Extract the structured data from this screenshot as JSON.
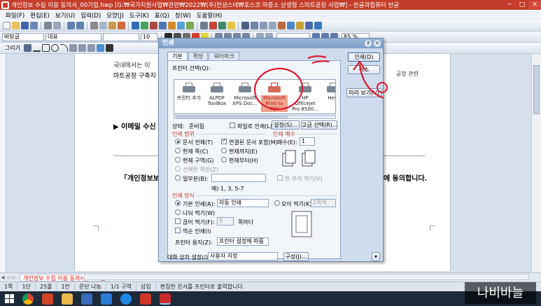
{
  "window": {
    "title": "개인정보 수집 이용 동의서_00기업.hwp [G:₩국가지원사업₩관련₩2022₩(주)전성스테₩포스코 마중소 상생형 스마트공장 사업₩] - 한글과컴퓨터 한글",
    "minimize": "─",
    "maximize": "□",
    "close": "✕"
  },
  "menu": [
    "파일(F)",
    "편집(E)",
    "보기(U)",
    "입력(D)",
    "모양(J)",
    "도구(K)",
    "표(Q)",
    "창(W)",
    "도움말(H)"
  ],
  "toolbar": {
    "style_combo": "바탕글",
    "font_combo": "대표",
    "size_combo": "10",
    "zoom_combo": "85 %",
    "draw_label": "그리기"
  },
  "document": {
    "line1": "국내에서는 이",
    "line2": "마트공장 구축지",
    "line2_right": "공장 관련",
    "bullet": "▶ 이메일 수신",
    "consent_left": "「개인정보보",
    "consent_right": "에 동의합니다."
  },
  "dialog": {
    "title": "인쇄",
    "tabs": [
      "기본",
      "확장",
      "워터마크"
    ],
    "printer_select_label": "프린터 선택(Q):",
    "printers": [
      {
        "name": "프린터 추가",
        "selected": false
      },
      {
        "name": "ALPDF ToolBox",
        "selected": false
      },
      {
        "name": "Microsoft XPS Doc...",
        "selected": false
      },
      {
        "name": "Microsoft Print to PDF",
        "selected": true
      },
      {
        "name": "HP Officejet Pro 8500...",
        "selected": false
      },
      {
        "name": "Hew",
        "selected": false
      }
    ],
    "status_label": "상태:",
    "status_value": "준비됨",
    "print_to_file": "파일로 인쇄(L)",
    "settings_button": "설정(S)...",
    "advanced_button": "고급 선택(R)...",
    "range_group": "인쇄 범위",
    "range_options": [
      {
        "label": "문서 전체(T)",
        "checked": true
      },
      {
        "label": "현재 쪽(C)",
        "checked": false
      },
      {
        "label": "현재 구역(G)",
        "checked": false
      },
      {
        "label": "선택한 쪽만(Z)",
        "checked": false
      },
      {
        "label": "일부분(B):",
        "checked": false
      }
    ],
    "linked_docs": "연결된 문서 포함(M)",
    "from_current": "현재까지(E)",
    "current_section": "현재부터(H)",
    "range_example": "예) 1, 3, 5-7",
    "copies_group": "인쇄 매수",
    "copies_label": "매수(E):",
    "copies_value": "1",
    "collate": "한 부씩 찍기(V)",
    "method_group": "인쇄 방식",
    "method_basic": "기본 인쇄(A):",
    "method_basic_value": "자동 인쇄",
    "method_gather": "모아 찍기(K):",
    "method_gather_value": "2쪽씩",
    "method_split": "나눠 찍기(W)",
    "method_stack": "끊어 찍기(F):",
    "method_stack_value": "5",
    "method_stack_unit": "쪽마다",
    "method_reverse": "역순 인쇄(I)",
    "printer_paper_label": "프린터 용지(Z):",
    "printer_paper_value": "프린터 설정에 따름",
    "dialog_setting_label": "대화 상자 설정(/):",
    "dialog_setting_value": "사용자 지정",
    "compose_button": "구성(J)...",
    "print_button": "인쇄(D)",
    "cancel_button": "취소",
    "preview_button": "미리 보기(V)"
  },
  "tabbar": {
    "doc_tab": "개인정보 수집 이용 동의서_00기업"
  },
  "status": {
    "page": "1쪽",
    "section": "1단",
    "line": "25줄",
    "col": "1칸",
    "break": "문단 나눔",
    "pos": "1/1 구역",
    "mode": "삽입",
    "msg": "편집한 문서를 프린터로 출력합니다."
  },
  "watermark": "나비바늘",
  "colors": {
    "titlebar": "#c43d2a",
    "annotation": "#e0182c",
    "selected_printer": "#f0a38f"
  }
}
